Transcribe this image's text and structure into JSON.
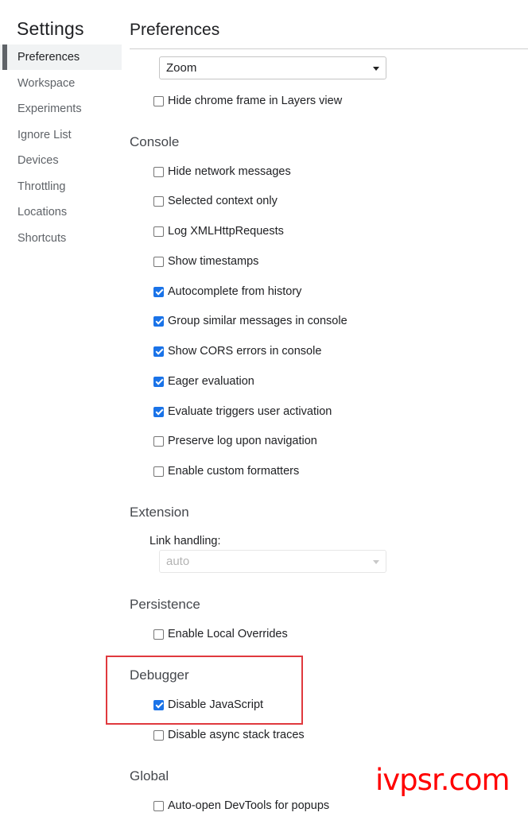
{
  "sidebar": {
    "title": "Settings",
    "items": [
      {
        "label": "Preferences",
        "selected": true
      },
      {
        "label": "Workspace"
      },
      {
        "label": "Experiments"
      },
      {
        "label": "Ignore List"
      },
      {
        "label": "Devices"
      },
      {
        "label": "Throttling"
      },
      {
        "label": "Locations"
      },
      {
        "label": "Shortcuts"
      }
    ]
  },
  "main": {
    "title": "Preferences",
    "zoom_select": {
      "value": "Zoom"
    },
    "hide_chrome_frame": {
      "label": "Hide chrome frame in Layers view",
      "checked": false
    },
    "console": {
      "title": "Console",
      "options": [
        {
          "label": "Hide network messages",
          "checked": false
        },
        {
          "label": "Selected context only",
          "checked": false
        },
        {
          "label": "Log XMLHttpRequests",
          "checked": false
        },
        {
          "label": "Show timestamps",
          "checked": false
        },
        {
          "label": "Autocomplete from history",
          "checked": true
        },
        {
          "label": "Group similar messages in console",
          "checked": true
        },
        {
          "label": "Show CORS errors in console",
          "checked": true
        },
        {
          "label": "Eager evaluation",
          "checked": true
        },
        {
          "label": "Evaluate triggers user activation",
          "checked": true
        },
        {
          "label": "Preserve log upon navigation",
          "checked": false
        },
        {
          "label": "Enable custom formatters",
          "checked": false
        }
      ]
    },
    "extension": {
      "title": "Extension",
      "link_handling_label": "Link handling:",
      "link_handling_value": "auto"
    },
    "persistence": {
      "title": "Persistence",
      "options": [
        {
          "label": "Enable Local Overrides",
          "checked": false
        }
      ]
    },
    "debugger": {
      "title": "Debugger",
      "options": [
        {
          "label": "Disable JavaScript",
          "checked": true
        },
        {
          "label": "Disable async stack traces",
          "checked": false
        }
      ]
    },
    "global": {
      "title": "Global",
      "options": [
        {
          "label": "Auto-open DevTools for popups",
          "checked": false
        }
      ]
    }
  },
  "watermark": "ivpsr.com",
  "colors": {
    "accent": "#1a73e8",
    "highlight": "#e0393e",
    "watermark": "#ff0000"
  }
}
